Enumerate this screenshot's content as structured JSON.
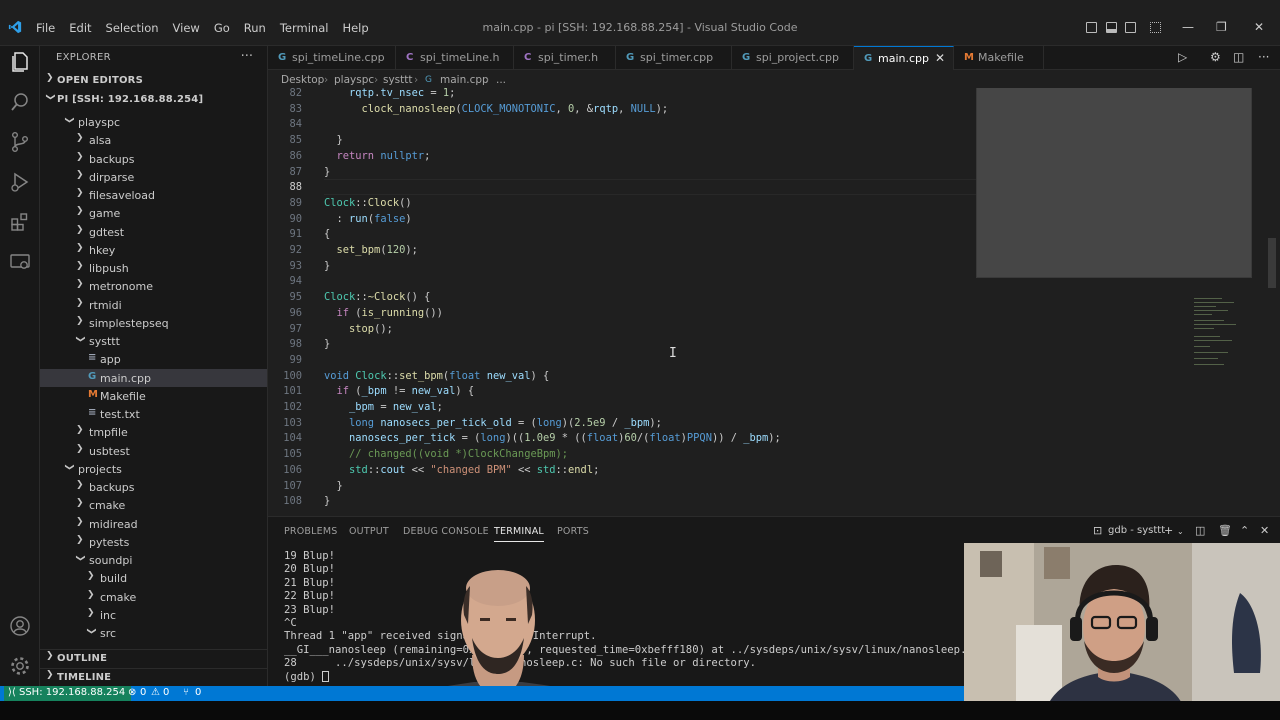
{
  "window": {
    "title": "main.cpp - pi [SSH: 192.168.88.254] - Visual Studio Code",
    "menu": [
      "File",
      "Edit",
      "Selection",
      "View",
      "Go",
      "Run",
      "Terminal",
      "Help"
    ]
  },
  "sidebar": {
    "header": "EXPLORER",
    "open_editors": "OPEN EDITORS",
    "root": "PI [SSH: 192.168.88.254]",
    "outline": "OUTLINE",
    "timeline": "TIMELINE",
    "tree": [
      {
        "name": "playspc",
        "type": "folder-open",
        "depth": 1
      },
      {
        "name": "alsa",
        "type": "folder",
        "depth": 2
      },
      {
        "name": "backups",
        "type": "folder",
        "depth": 2
      },
      {
        "name": "dirparse",
        "type": "folder",
        "depth": 2
      },
      {
        "name": "filesaveload",
        "type": "folder",
        "depth": 2
      },
      {
        "name": "game",
        "type": "folder",
        "depth": 2
      },
      {
        "name": "gdtest",
        "type": "folder",
        "depth": 2
      },
      {
        "name": "hkey",
        "type": "folder",
        "depth": 2
      },
      {
        "name": "libpush",
        "type": "folder",
        "depth": 2
      },
      {
        "name": "metronome",
        "type": "folder",
        "depth": 2
      },
      {
        "name": "rtmidi",
        "type": "folder",
        "depth": 2
      },
      {
        "name": "simplestepseq",
        "type": "folder",
        "depth": 2
      },
      {
        "name": "systtt",
        "type": "folder-open",
        "depth": 2
      },
      {
        "name": "app",
        "type": "file-text",
        "depth": 3
      },
      {
        "name": "main.cpp",
        "type": "file-cpp",
        "depth": 3
      },
      {
        "name": "Makefile",
        "type": "file-make",
        "depth": 3
      },
      {
        "name": "test.txt",
        "type": "file-text",
        "depth": 3
      },
      {
        "name": "tmpfile",
        "type": "folder",
        "depth": 2
      },
      {
        "name": "usbtest",
        "type": "folder",
        "depth": 2
      },
      {
        "name": "projects",
        "type": "folder-open",
        "depth": 1
      },
      {
        "name": "backups",
        "type": "folder",
        "depth": 2
      },
      {
        "name": "cmake",
        "type": "folder",
        "depth": 2
      },
      {
        "name": "midiread",
        "type": "folder",
        "depth": 2
      },
      {
        "name": "pytests",
        "type": "folder",
        "depth": 2
      },
      {
        "name": "soundpi",
        "type": "folder-open",
        "depth": 2
      },
      {
        "name": "build",
        "type": "folder",
        "depth": 3
      },
      {
        "name": "cmake",
        "type": "folder",
        "depth": 3
      },
      {
        "name": "inc",
        "type": "folder",
        "depth": 3
      },
      {
        "name": "src",
        "type": "folder-open",
        "depth": 3
      }
    ]
  },
  "tabs": [
    {
      "label": "spi_timeLine.cpp",
      "icon": "cpp-icon"
    },
    {
      "label": "spi_timeLine.h",
      "icon": "c-header-icon"
    },
    {
      "label": "spi_timer.h",
      "icon": "c-header-icon"
    },
    {
      "label": "spi_timer.cpp",
      "icon": "cpp-icon"
    },
    {
      "label": "spi_project.cpp",
      "icon": "cpp-icon"
    },
    {
      "label": "main.cpp",
      "icon": "cpp-icon",
      "active": true
    },
    {
      "label": "Makefile",
      "icon": "makefile-icon"
    }
  ],
  "breadcrumb": [
    "Desktop",
    "playspc",
    "systtt",
    "main.cpp",
    "..."
  ],
  "editor": {
    "current_line": 88,
    "lines": [
      {
        "n": "82",
        "html": "    <span class='var'>rqtp</span>.<span class='var'>tv_nsec</span> = <span class='num'>1</span>;"
      },
      {
        "n": "83",
        "html": "      <span class='fn'>clock_nanosleep</span>(<span class='mac'>CLOCK_MONOTONIC</span>, <span class='num'>0</span>, &amp;<span class='var'>rqtp</span>, <span class='kw'>NULL</span>);"
      },
      {
        "n": "84",
        "html": ""
      },
      {
        "n": "85",
        "html": "  }"
      },
      {
        "n": "86",
        "html": "  <span class='ctl'>return</span> <span class='kw'>nullptr</span>;"
      },
      {
        "n": "87",
        "html": "}"
      },
      {
        "n": "88",
        "html": ""
      },
      {
        "n": "89",
        "html": "<span class='ty'>Clock</span>::<span class='fn'>Clock</span>()"
      },
      {
        "n": "90",
        "html": "  : <span class='var'>run</span>(<span class='kw'>false</span>)"
      },
      {
        "n": "91",
        "html": "{"
      },
      {
        "n": "92",
        "html": "  <span class='fn'>set_bpm</span>(<span class='num'>120</span>);"
      },
      {
        "n": "93",
        "html": "}"
      },
      {
        "n": "94",
        "html": ""
      },
      {
        "n": "95",
        "html": "<span class='ty'>Clock</span>::<span class='fn'>~Clock</span>() {"
      },
      {
        "n": "96",
        "html": "  <span class='ctl'>if</span> (<span class='fn'>is_running</span>())"
      },
      {
        "n": "97",
        "html": "    <span class='fn'>stop</span>();"
      },
      {
        "n": "98",
        "html": "}"
      },
      {
        "n": "99",
        "html": ""
      },
      {
        "n": "100",
        "html": "<span class='kw'>void</span> <span class='ty'>Clock</span>::<span class='fn'>set_bpm</span>(<span class='kw'>float</span> <span class='var'>new_val</span>) {"
      },
      {
        "n": "101",
        "html": "  <span class='ctl'>if</span> (<span class='var'>_bpm</span> != <span class='var'>new_val</span>) {"
      },
      {
        "n": "102",
        "html": "    <span class='var'>_bpm</span> = <span class='var'>new_val</span>;"
      },
      {
        "n": "103",
        "html": "    <span class='kw'>long</span> <span class='var'>nanosecs_per_tick_old</span> = (<span class='kw'>long</span>)(<span class='num'>2.5e9</span> / <span class='var'>_bpm</span>);"
      },
      {
        "n": "104",
        "html": "    <span class='var'>nanosecs_per_tick</span> = (<span class='kw'>long</span>)((<span class='num'>1.0e9</span> * ((<span class='kw'>float</span>)<span class='num'>60</span>/(<span class='kw'>float</span>)<span class='mac'>PPQN</span>)) / <span class='var'>_bpm</span>);"
      },
      {
        "n": "105",
        "html": "    <span class='cm'>// changed((void *)ClockChangeBpm);</span>"
      },
      {
        "n": "106",
        "html": "    <span class='ty'>std</span>::<span class='var'>cout</span> &lt;&lt; <span class='str'>\"changed BPM\"</span> &lt;&lt; <span class='ty'>std</span>::<span class='fn'>endl</span>;"
      },
      {
        "n": "107",
        "html": "  }"
      },
      {
        "n": "108",
        "html": "}"
      }
    ]
  },
  "panel": {
    "tabs": [
      "PROBLEMS",
      "OUTPUT",
      "DEBUG CONSOLE",
      "TERMINAL",
      "PORTS"
    ],
    "active_tab": "TERMINAL",
    "terminal_name": "gdb - systtt",
    "terminal_lines": [
      "19 Blup!",
      "20 Blup!",
      "21 Blup!",
      "22 Blup!",
      "23 Blup!",
      "^C",
      "Thread 1 \"app\" received signal SIGINT, Interrupt.",
      "__GI___nanosleep (remaining=0xbefff180, requested_time=0xbefff180) at ../sysdeps/unix/sysv/linux/nanosleep.c:28",
      "28      ../sysdeps/unix/sysv/linux/nanosleep.c: No such file or directory.",
      "(gdb) "
    ]
  },
  "status": {
    "remote": "SSH: 192.168.88.254",
    "errors": "0",
    "warnings": "0",
    "ports": "0"
  },
  "colors": {
    "accent": "#0078d4",
    "remote": "#16825d"
  }
}
